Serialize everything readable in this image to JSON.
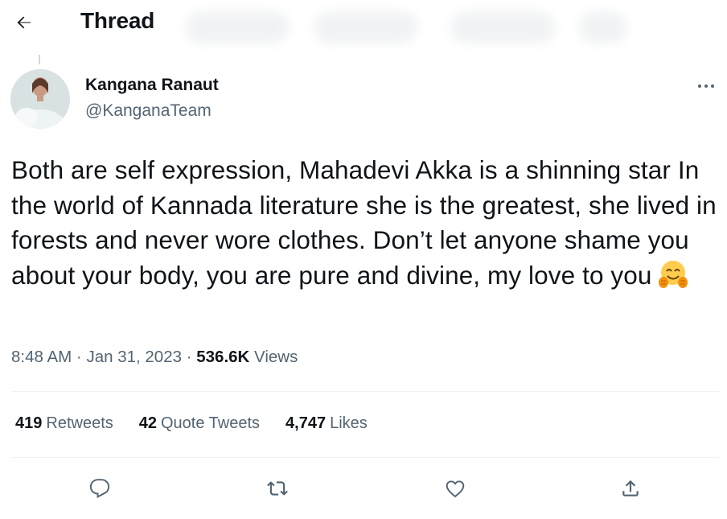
{
  "header": {
    "back_icon": "arrow-left-icon",
    "title": "Thread"
  },
  "author": {
    "name": "Kangana Ranaut",
    "handle": "@KanganaTeam",
    "more_icon": "more-horizontal-icon"
  },
  "tweet": {
    "text": "Both are self expression, Mahadevi Akka is a shinning star In the world of Kannada literature she is the greatest, she lived in forests and never wore clothes. Don’t let anyone shame you about your body, you are pure and divine, my love to you",
    "emoji": "hugging-face-emoji",
    "time": "8:48 AM",
    "sep1": "·",
    "date": "Jan 31, 2023",
    "sep2": "·",
    "views_count": "536.6K",
    "views_label": "Views"
  },
  "stats": {
    "retweets_count": "419",
    "retweets_label": "Retweets",
    "quotes_count": "42",
    "quotes_label": "Quote Tweets",
    "likes_count": "4,747",
    "likes_label": "Likes"
  },
  "actions": {
    "reply_icon": "reply-icon",
    "retweet_icon": "retweet-icon",
    "like_icon": "heart-icon",
    "share_icon": "share-icon"
  },
  "colors": {
    "text_primary": "#0f1419",
    "text_secondary": "#536471",
    "divider": "#eff3f4"
  }
}
